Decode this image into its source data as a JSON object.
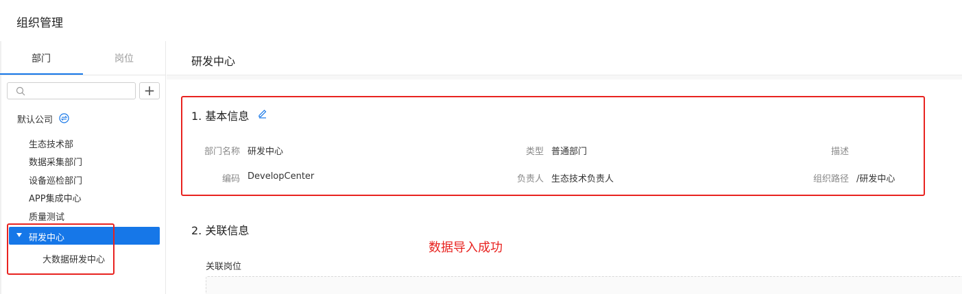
{
  "app": {
    "title": "组织管理"
  },
  "sidebar": {
    "tabs": [
      {
        "label": "部门"
      },
      {
        "label": "岗位"
      }
    ],
    "search": {
      "placeholder": ""
    },
    "add_label": "+",
    "company": {
      "label": "默认公司"
    },
    "items": [
      {
        "label": "生态技术部"
      },
      {
        "label": "数据采集部门"
      },
      {
        "label": "设备巡检部门"
      },
      {
        "label": "APP集成中心"
      },
      {
        "label": "质量测试"
      },
      {
        "label": "研发中心"
      },
      {
        "label": "大数据研发中心"
      }
    ]
  },
  "main": {
    "title": "研发中心",
    "basic": {
      "title": "1. 基本信息",
      "fields": {
        "dept_name_label": "部门名称",
        "dept_name_value": "研发中心",
        "type_label": "类型",
        "type_value": "普通部门",
        "desc_label": "描述",
        "desc_value": "",
        "code_label": "编码",
        "code_value": "DevelopCenter",
        "owner_label": "负责人",
        "owner_value": "生态技术负责人",
        "path_label": "组织路径",
        "path_value": "/研发中心"
      }
    },
    "related": {
      "title": "2. 关联信息",
      "positions_label": "关联岗位"
    },
    "success_message": "数据导入成功"
  },
  "colors": {
    "accent": "#1677e8",
    "annotation": "#e8221f"
  }
}
